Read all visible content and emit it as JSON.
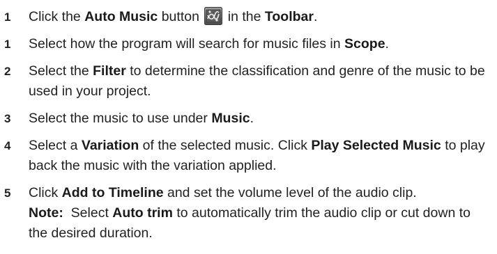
{
  "steps": [
    {
      "number": "1",
      "t1": "Click the ",
      "b1": "Auto Music",
      "t2": " button ",
      "icon": "auto-music-icon",
      "t3": " in the ",
      "b2": "Toolbar",
      "t4": "."
    },
    {
      "number": "1",
      "t1": "Select how the program will search for music files in ",
      "b1": "Scope",
      "t2": "."
    },
    {
      "number": "2",
      "t1": "Select the ",
      "b1": "Filter",
      "t2": " to determine the classification and genre of the music to be used in your project."
    },
    {
      "number": "3",
      "t1": "Select the music to use under ",
      "b1": "Music",
      "t2": "."
    },
    {
      "number": "4",
      "t1": "Select a ",
      "b1": "Variation",
      "t2": " of the selected music. Click ",
      "b2": "Play Selected Music",
      "t3": " to play back the music with the variation applied."
    },
    {
      "number": "5",
      "t1": "Click ",
      "b1": "Add to Timeline",
      "t2": " and set the volume level of the audio clip.",
      "note": {
        "label": "Note:",
        "t1": "  Select ",
        "b1": "Auto trim",
        "t2": " to automatically trim the audio clip or cut down to the desired duration."
      }
    }
  ]
}
